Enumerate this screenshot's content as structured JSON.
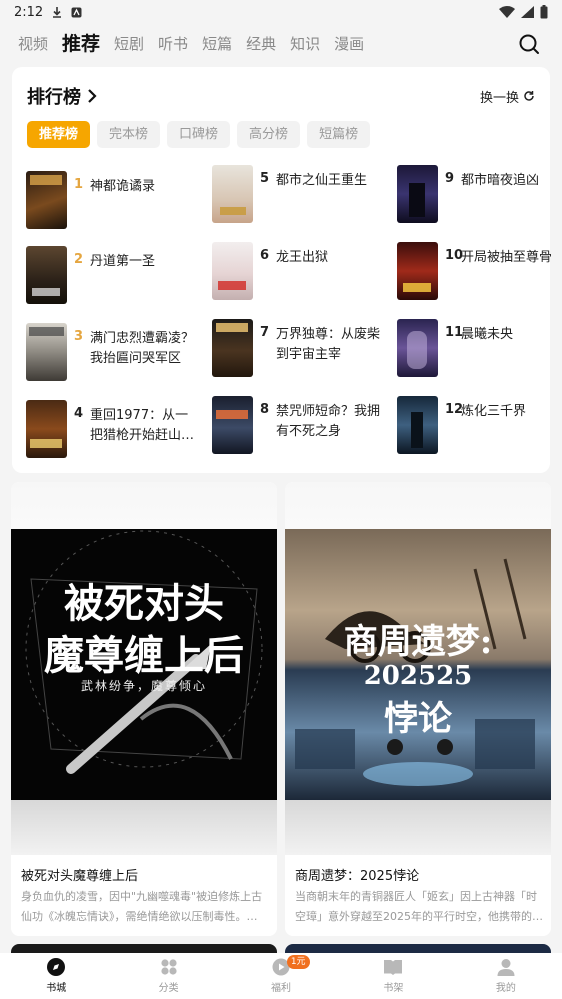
{
  "status_bar": {
    "time": "2:12"
  },
  "top_tabs": [
    "视频",
    "推荐",
    "短剧",
    "听书",
    "短篇",
    "经典",
    "知识",
    "漫画"
  ],
  "active_tab": "推荐",
  "ranking": {
    "title": "排行榜",
    "swap_label": "换一换",
    "chips": [
      "推荐榜",
      "完本榜",
      "口碑榜",
      "高分榜",
      "短篇榜"
    ],
    "active_chip": "推荐榜",
    "items": [
      {
        "rank": "1",
        "name": "神都诡谲录"
      },
      {
        "rank": "2",
        "name": "丹道第一圣"
      },
      {
        "rank": "3",
        "name": "满门忠烈遭霸凌？我抬匾问哭军区"
      },
      {
        "rank": "4",
        "name": "重回1977：从一把猎枪开始赶山…"
      },
      {
        "rank": "5",
        "name": "都市之仙王重生"
      },
      {
        "rank": "6",
        "name": "龙王出狱"
      },
      {
        "rank": "7",
        "name": "万界独尊：从废柴到宇宙主宰"
      },
      {
        "rank": "8",
        "name": "禁咒师短命？我拥有不死之身"
      },
      {
        "rank": "9",
        "name": "都市暗夜追凶"
      },
      {
        "rank": "10",
        "name": "开局被抽至尊骨"
      },
      {
        "rank": "11",
        "name": "晨曦未央"
      },
      {
        "rank": "12",
        "name": "炼化三千界"
      }
    ]
  },
  "feed": [
    {
      "cover_title_line1": "被死对头",
      "cover_title_line2": "魔尊缠上后",
      "cover_subtitle": "武林纷争，魔尊倾心",
      "title": "被死对头魔尊缠上后",
      "desc": "身负血仇的凌雪，因中\"九幽噬魂毒\"被迫修炼上古仙功《冰魄忘情诀》，需绝情绝欲以压制毒性。…"
    },
    {
      "cover_title_line1": "商周遗梦:",
      "cover_title_line2": "202525",
      "cover_title_line3": "悖论",
      "title": "商周遗梦：2025悖论",
      "desc": "当商朝末年的青铜器匠人「姬玄」因上古神器「时空璋」意外穿越至2025年的平行时空，他携带的…"
    }
  ],
  "bottom_nav": [
    {
      "label": "书城",
      "icon": "book-city-icon"
    },
    {
      "label": "分类",
      "icon": "category-icon"
    },
    {
      "label": "福利",
      "icon": "welfare-icon",
      "badge": "1元"
    },
    {
      "label": "书架",
      "icon": "bookshelf-icon"
    },
    {
      "label": "我的",
      "icon": "profile-icon"
    }
  ],
  "colors": {
    "accent": "#f6a600",
    "rank_gold": "#e5a640",
    "badge": "#f07020"
  }
}
